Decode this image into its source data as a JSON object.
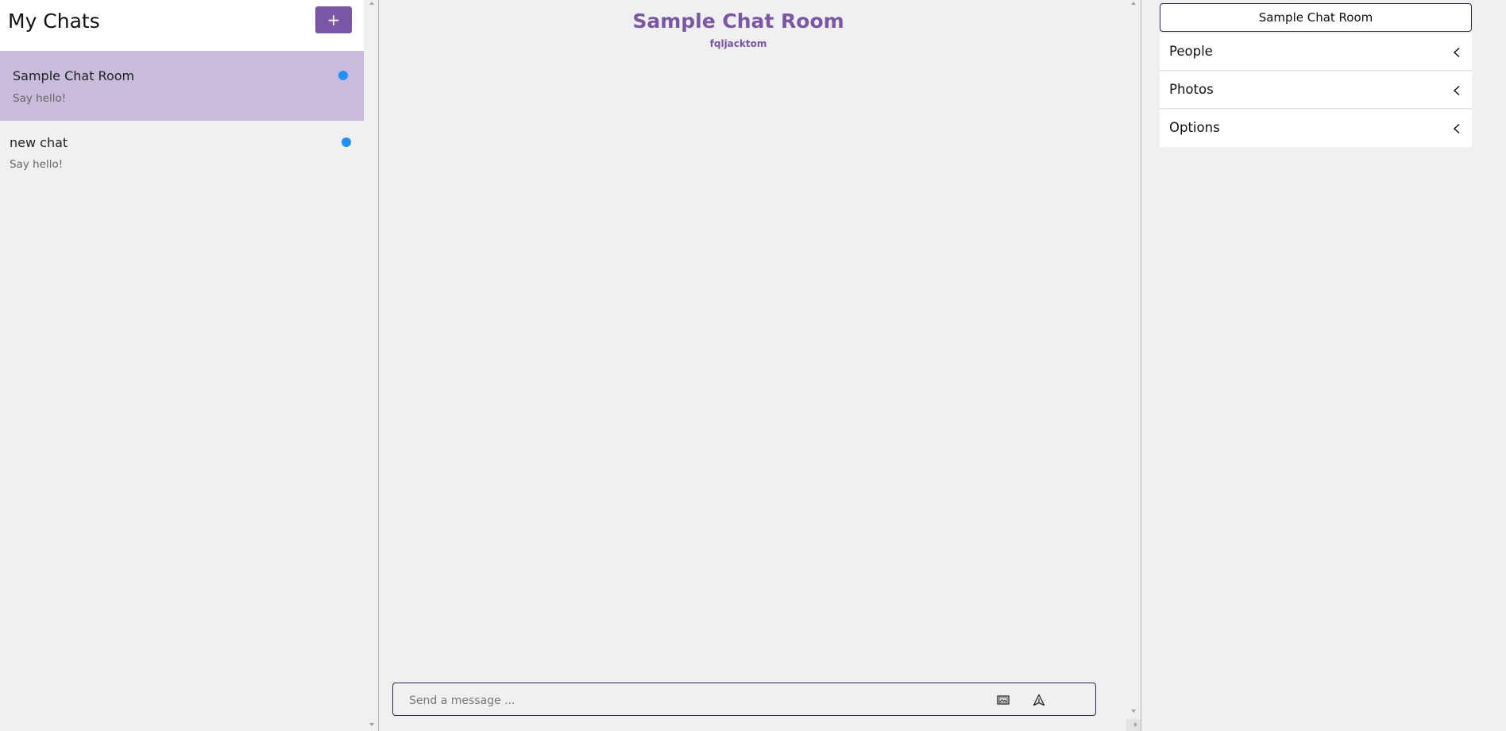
{
  "sidebar": {
    "title": "My Chats",
    "new_chat_button": "+",
    "chats": [
      {
        "title": "Sample Chat Room",
        "preview": "Say hello!",
        "unread": true,
        "active": true
      },
      {
        "title": "new chat",
        "preview": "Say hello!",
        "unread": true,
        "active": false
      }
    ]
  },
  "chat": {
    "title": "Sample Chat Room",
    "subtitle": "fqljacktom",
    "composer": {
      "placeholder": "Send a message ...",
      "value": ""
    }
  },
  "settings": {
    "room_name": "Sample Chat Room",
    "sections": [
      {
        "label": "People",
        "icon": "chevron-left-icon"
      },
      {
        "label": "Photos",
        "icon": "chevron-left-icon"
      },
      {
        "label": "Options",
        "icon": "chevron-left-icon"
      }
    ]
  },
  "colors": {
    "accent": "#7a56a6",
    "active_chat": "#c9bbdc",
    "unread_dot": "#1e90ff",
    "background": "#f0f0f0"
  }
}
